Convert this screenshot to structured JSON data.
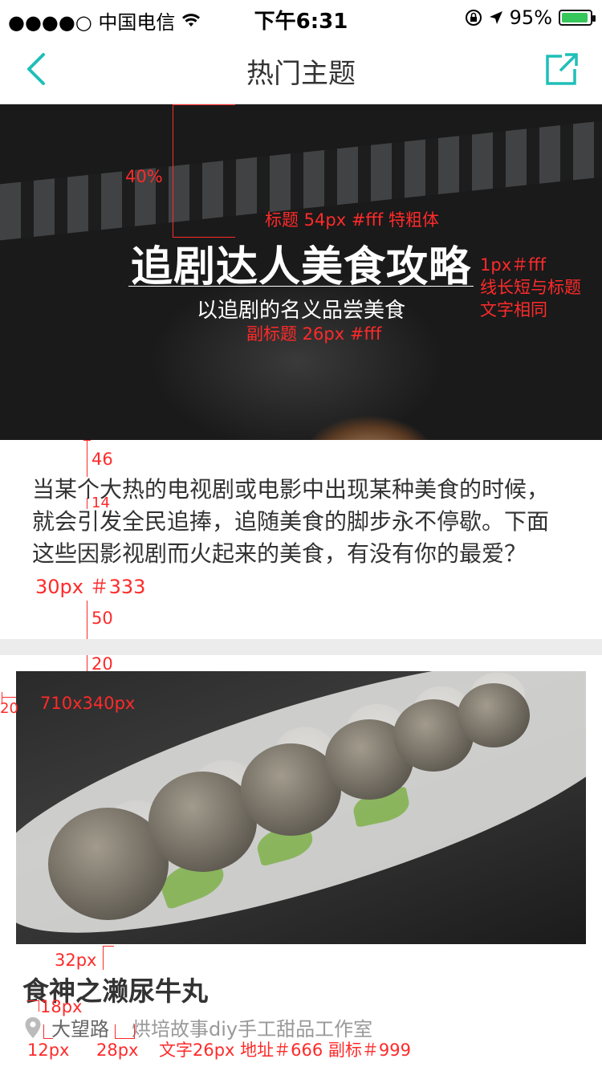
{
  "status_bar": {
    "carrier": "●●●●○ 中国电信",
    "time": "下午6:31",
    "battery": "95%",
    "battery_level": 0.95
  },
  "nav": {
    "title": "热门主题",
    "back_icon": "chevron-left-icon",
    "share_icon": "share-icon",
    "accent": "#1fbfb8"
  },
  "hero": {
    "title": "追剧达人美食攻略",
    "subtitle": "以追剧的名义品尝美食"
  },
  "intro": {
    "text": "当某个大热的电视剧或电影中出现某种美食的时候，就会引发全民追捧，追随美食的脚步永不停歇。下面这些因影视剧而火起来的美食，有没有你的最爱？"
  },
  "article": {
    "title": "食神之濑尿牛丸",
    "address": "大望路",
    "shop": "烘培故事diy手工甜品工作室",
    "location_icon": "map-pin-icon"
  },
  "annotations": {
    "hero_top": "40%",
    "title_spec": "标题 54px #fff 特粗体",
    "line_spec": "1px＃fff\n线长短与标题\n文字相同",
    "subtitle_spec": "副标题 26px #fff",
    "gap_46": "46",
    "gap_14": "14",
    "text_spec": "30px ＃333",
    "gap_50": "50",
    "gap_20a": "20",
    "gap_20b": "20",
    "margin_20": "20",
    "image_spec": "710x340px",
    "gap_32": "32px",
    "gap_18": "18px",
    "gap_12": "12px",
    "gap_28": "28px",
    "meta_spec": "文字26px 地址＃666 副标＃999"
  }
}
